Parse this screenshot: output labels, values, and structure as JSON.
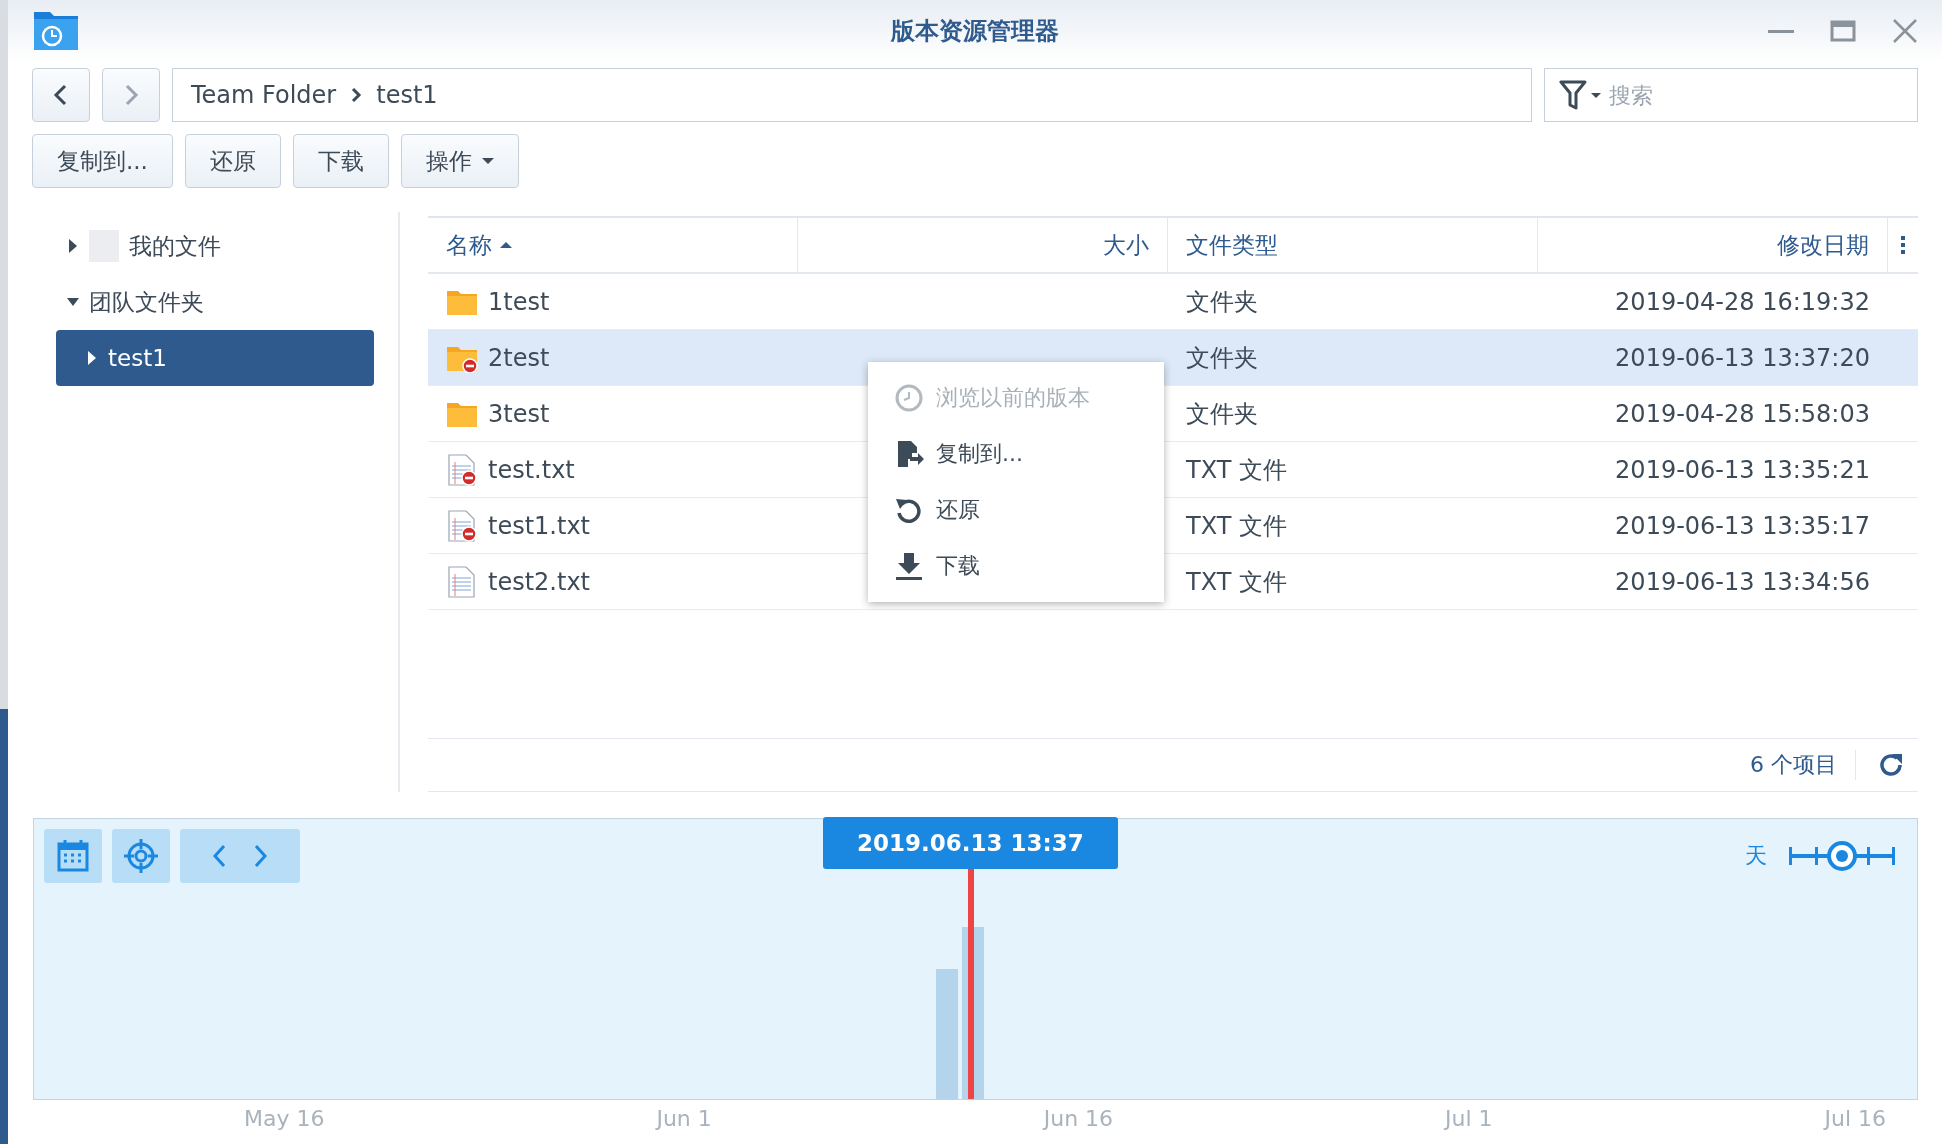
{
  "window": {
    "title": "版本资源管理器"
  },
  "navigation": {
    "breadcrumb": [
      "Team Folder",
      "test1"
    ]
  },
  "search": {
    "placeholder": "搜索"
  },
  "toolbar": {
    "buttons": [
      {
        "label": "复制到...",
        "kind": "plain"
      },
      {
        "label": "还原",
        "kind": "plain"
      },
      {
        "label": "下载",
        "kind": "plain"
      },
      {
        "label": "操作",
        "kind": "dropdown"
      }
    ]
  },
  "sidebar": {
    "items": [
      {
        "label": "我的文件",
        "expanded": false,
        "selected": false
      },
      {
        "label": "团队文件夹",
        "expanded": true,
        "selected": false,
        "children": [
          {
            "label": "test1",
            "expanded": false,
            "selected": true
          }
        ]
      }
    ]
  },
  "table": {
    "columns": [
      {
        "label": "名称",
        "sorted": true
      },
      {
        "label": "大小",
        "sorted": false
      },
      {
        "label": "文件类型",
        "sorted": false
      },
      {
        "label": "修改日期",
        "sorted": false
      }
    ],
    "rows": [
      {
        "name": "1test",
        "kind": "folder",
        "deleted": false,
        "type": "文件夹",
        "modified": "2019-04-28 16:19:32",
        "selected": false
      },
      {
        "name": "2test",
        "kind": "folder",
        "deleted": true,
        "type": "文件夹",
        "modified": "2019-06-13 13:37:20",
        "selected": true
      },
      {
        "name": "3test",
        "kind": "folder",
        "deleted": false,
        "type": "文件夹",
        "modified": "2019-04-28 15:58:03",
        "selected": false
      },
      {
        "name": "test.txt",
        "kind": "file",
        "deleted": true,
        "type": "TXT 文件",
        "modified": "2019-06-13 13:35:21",
        "selected": false
      },
      {
        "name": "test1.txt",
        "kind": "file",
        "deleted": true,
        "type": "TXT 文件",
        "modified": "2019-06-13 13:35:17",
        "selected": false
      },
      {
        "name": "test2.txt",
        "kind": "file",
        "deleted": false,
        "type": "TXT 文件",
        "modified": "2019-06-13 13:34:56",
        "selected": false
      }
    ]
  },
  "footer": {
    "count": "6 个项目"
  },
  "context_menu": {
    "items": [
      {
        "label": "浏览以前的版本",
        "kind": "history",
        "disabled": true
      },
      {
        "label": "复制到...",
        "kind": "copy",
        "disabled": false
      },
      {
        "label": "还原",
        "kind": "restore",
        "disabled": false
      },
      {
        "label": "下载",
        "kind": "download",
        "disabled": false
      }
    ]
  },
  "timeline": {
    "current": "2019.06.13 13:37",
    "scale_label": "天",
    "scale": {
      "level": 0.5
    },
    "axis_labels": [
      "May 16",
      "Jun 1",
      "Jun 16",
      "Jul 1",
      "Jul 16"
    ]
  }
}
